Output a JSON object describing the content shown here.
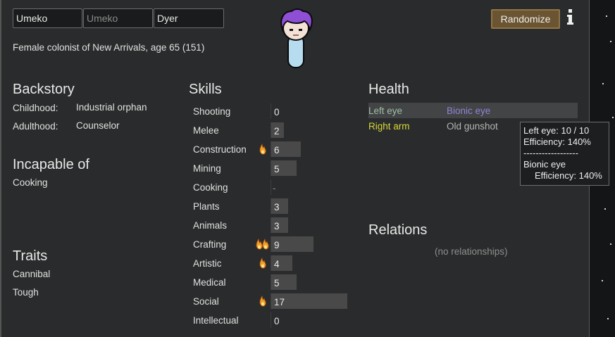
{
  "colonist": {
    "first_name": "Umeko",
    "nick_placeholder": "Umeko",
    "last_name": "Dyer",
    "description": "Female colonist of New Arrivals, age 65 (151)",
    "hair_color": "#8e4fd6"
  },
  "header": {
    "randomize_label": "Randomize"
  },
  "backstory": {
    "title": "Backstory",
    "childhood_label": "Childhood:",
    "childhood_value": "Industrial orphan",
    "adulthood_label": "Adulthood:",
    "adulthood_value": "Counselor"
  },
  "incapable": {
    "title": "Incapable of",
    "items": [
      "Cooking"
    ]
  },
  "traits": {
    "title": "Traits",
    "items": [
      "Cannibal",
      "Tough"
    ]
  },
  "skills": {
    "title": "Skills",
    "max_level": 20,
    "items": [
      {
        "name": "Shooting",
        "level": "0",
        "passion": 0
      },
      {
        "name": "Melee",
        "level": "2",
        "passion": 0
      },
      {
        "name": "Construction",
        "level": "6",
        "passion": 1
      },
      {
        "name": "Mining",
        "level": "5",
        "passion": 0
      },
      {
        "name": "Cooking",
        "level": "-",
        "passion": 0
      },
      {
        "name": "Plants",
        "level": "3",
        "passion": 0
      },
      {
        "name": "Animals",
        "level": "3",
        "passion": 0
      },
      {
        "name": "Crafting",
        "level": "9",
        "passion": 2
      },
      {
        "name": "Artistic",
        "level": "4",
        "passion": 1
      },
      {
        "name": "Medical",
        "level": "5",
        "passion": 0
      },
      {
        "name": "Social",
        "level": "17",
        "passion": 1
      },
      {
        "name": "Intellectual",
        "level": "0",
        "passion": 0
      }
    ]
  },
  "health": {
    "title": "Health",
    "rows": [
      {
        "part": "Left eye",
        "condition": "Bionic eye",
        "part_color": "#9fbfa6",
        "cond_color": "#8f84d6"
      },
      {
        "part": "Right arm",
        "condition": "Old gunshot",
        "part_color": "#d8d83a",
        "cond_color": "#b4b4b4"
      }
    ]
  },
  "relations": {
    "title": "Relations",
    "empty": "(no relationships)"
  },
  "tooltip": {
    "line1": "Left eye:  10 / 10",
    "line2": "Efficiency: 140%",
    "line3": "------------------",
    "line4": "Bionic eye",
    "line5": "Efficiency: 140%"
  }
}
